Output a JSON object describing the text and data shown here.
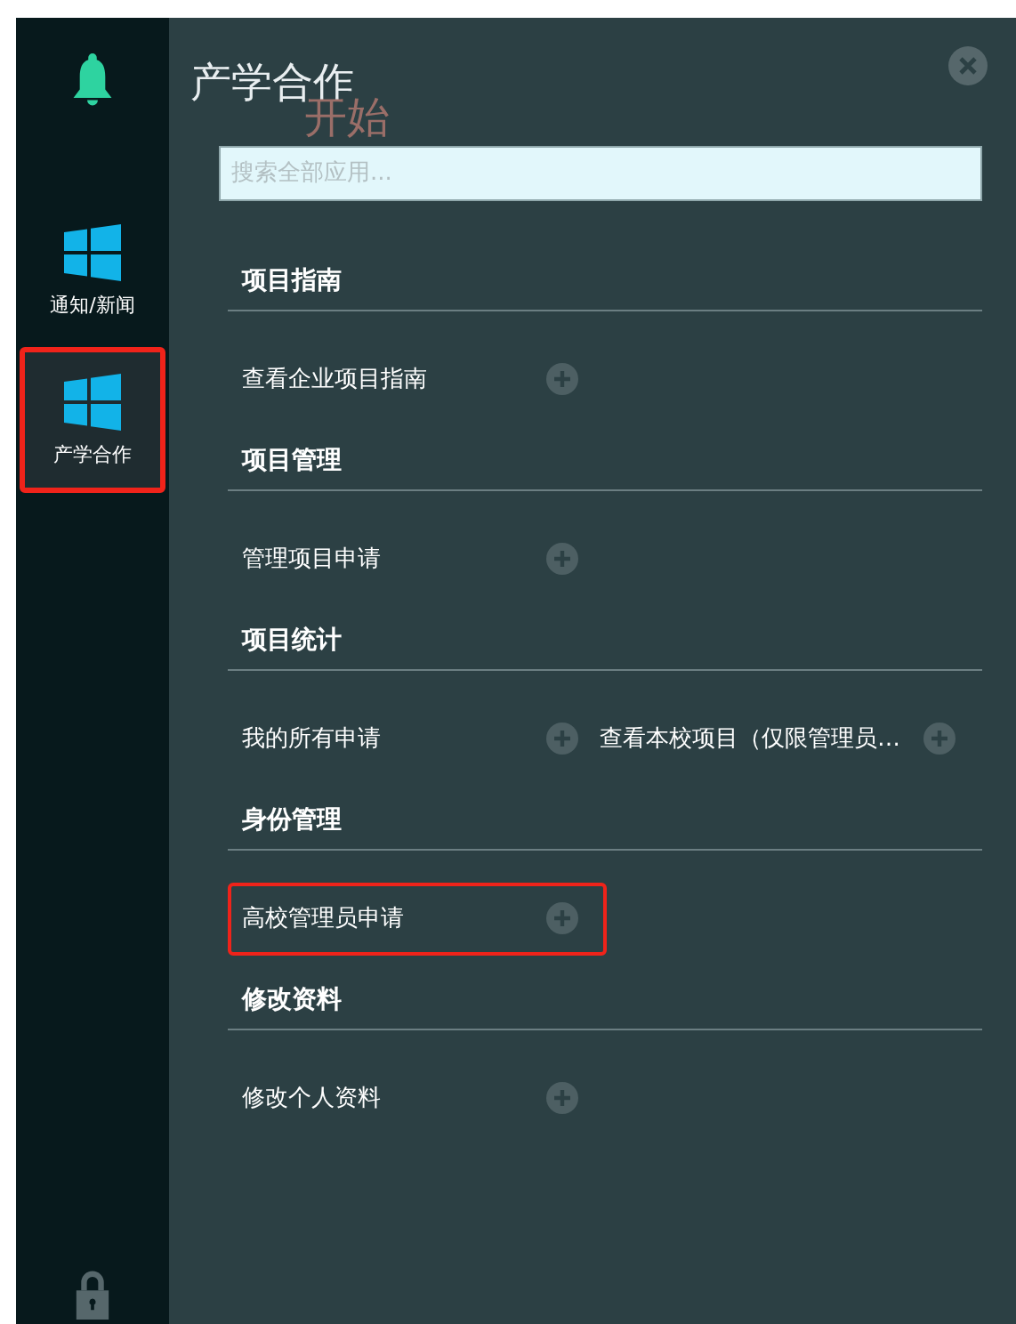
{
  "sidebar": {
    "items": [
      {
        "label": "通知/新闻",
        "selected": false,
        "annotated": false
      },
      {
        "label": "产学合作",
        "selected": true,
        "annotated": true
      }
    ]
  },
  "panel": {
    "title": "产学合作",
    "background_label": "开始",
    "search": {
      "placeholder": "搜索全部应用..."
    },
    "sections": [
      {
        "title": "项目指南",
        "items": [
          {
            "label": "查看企业项目指南",
            "annotated": false
          }
        ]
      },
      {
        "title": "项目管理",
        "items": [
          {
            "label": "管理项目申请",
            "annotated": false
          }
        ]
      },
      {
        "title": "项目统计",
        "items": [
          {
            "label": "我的所有申请",
            "annotated": false
          },
          {
            "label": "查看本校项目（仅限管理员…",
            "annotated": false
          }
        ]
      },
      {
        "title": "身份管理",
        "items": [
          {
            "label": "高校管理员申请",
            "annotated": true
          }
        ]
      },
      {
        "title": "修改资料",
        "items": [
          {
            "label": "修改个人资料",
            "annotated": false
          }
        ]
      }
    ]
  }
}
